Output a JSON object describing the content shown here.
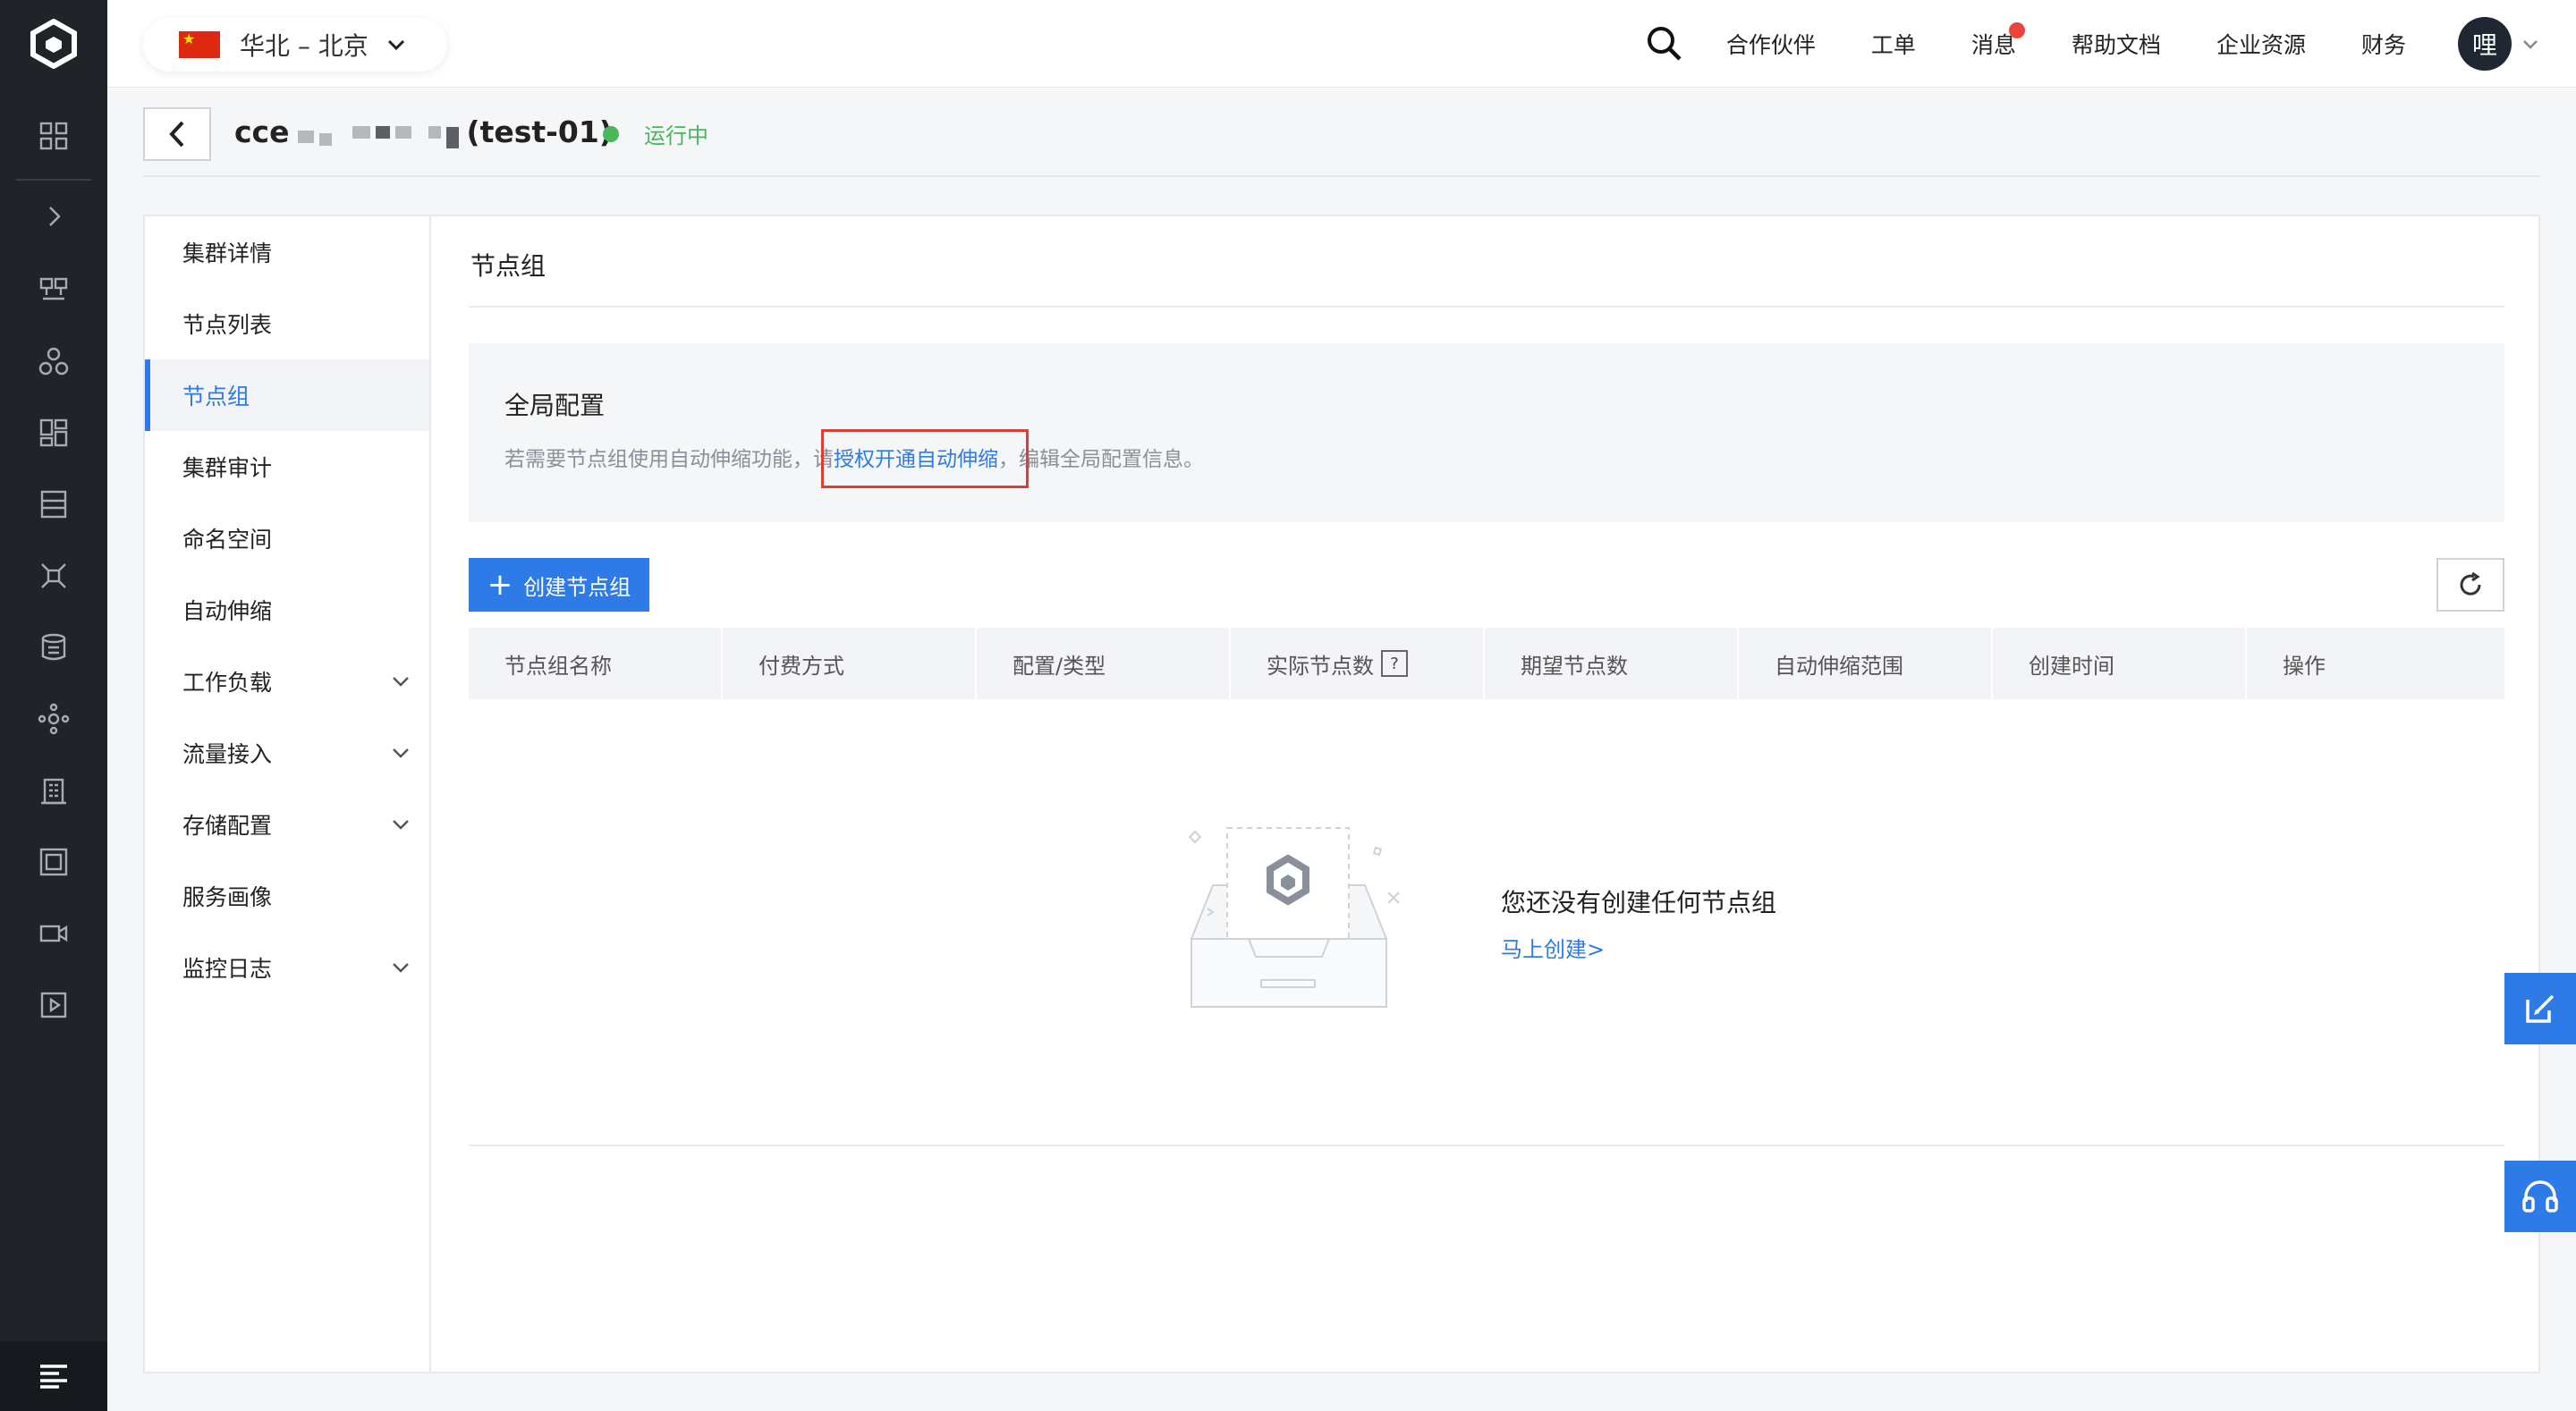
{
  "topbar": {
    "region": "华北 – 北京",
    "nav": [
      "合作伙伴",
      "工单",
      "消息",
      "帮助文档",
      "企业资源",
      "财务"
    ],
    "avatar_text": "哩"
  },
  "header": {
    "cluster_prefix": "cce",
    "cluster_suffix": "(test-01)",
    "status": "运行中"
  },
  "subnav": {
    "items": [
      {
        "label": "集群详情",
        "expand": false
      },
      {
        "label": "节点列表",
        "expand": false
      },
      {
        "label": "节点组",
        "expand": false,
        "active": true
      },
      {
        "label": "集群审计",
        "expand": false
      },
      {
        "label": "命名空间",
        "expand": false
      },
      {
        "label": "自动伸缩",
        "expand": false
      },
      {
        "label": "工作负载",
        "expand": true
      },
      {
        "label": "流量接入",
        "expand": true
      },
      {
        "label": "存储配置",
        "expand": true
      },
      {
        "label": "服务画像",
        "expand": false
      },
      {
        "label": "监控日志",
        "expand": true
      }
    ]
  },
  "page": {
    "title": "节点组",
    "global_config": {
      "title": "全局配置",
      "desc_before": "若需要节点组使用自动伸缩功能，请",
      "link": "授权开通自动伸缩",
      "desc_after": "，编辑全局配置信息。"
    },
    "create_button": "创建节点组",
    "table": {
      "columns": [
        "节点组名称",
        "付费方式",
        "配置/类型",
        "实际节点数",
        "期望节点数",
        "自动伸缩范围",
        "创建时间",
        "操作"
      ],
      "help_mark": "?"
    },
    "empty": {
      "text": "您还没有创建任何节点组",
      "link": "马上创建>"
    }
  },
  "colors": {
    "primary": "#2e7ae6",
    "success": "#49b85b",
    "rail_bg": "#202429",
    "highlight_border": "#e53935"
  }
}
